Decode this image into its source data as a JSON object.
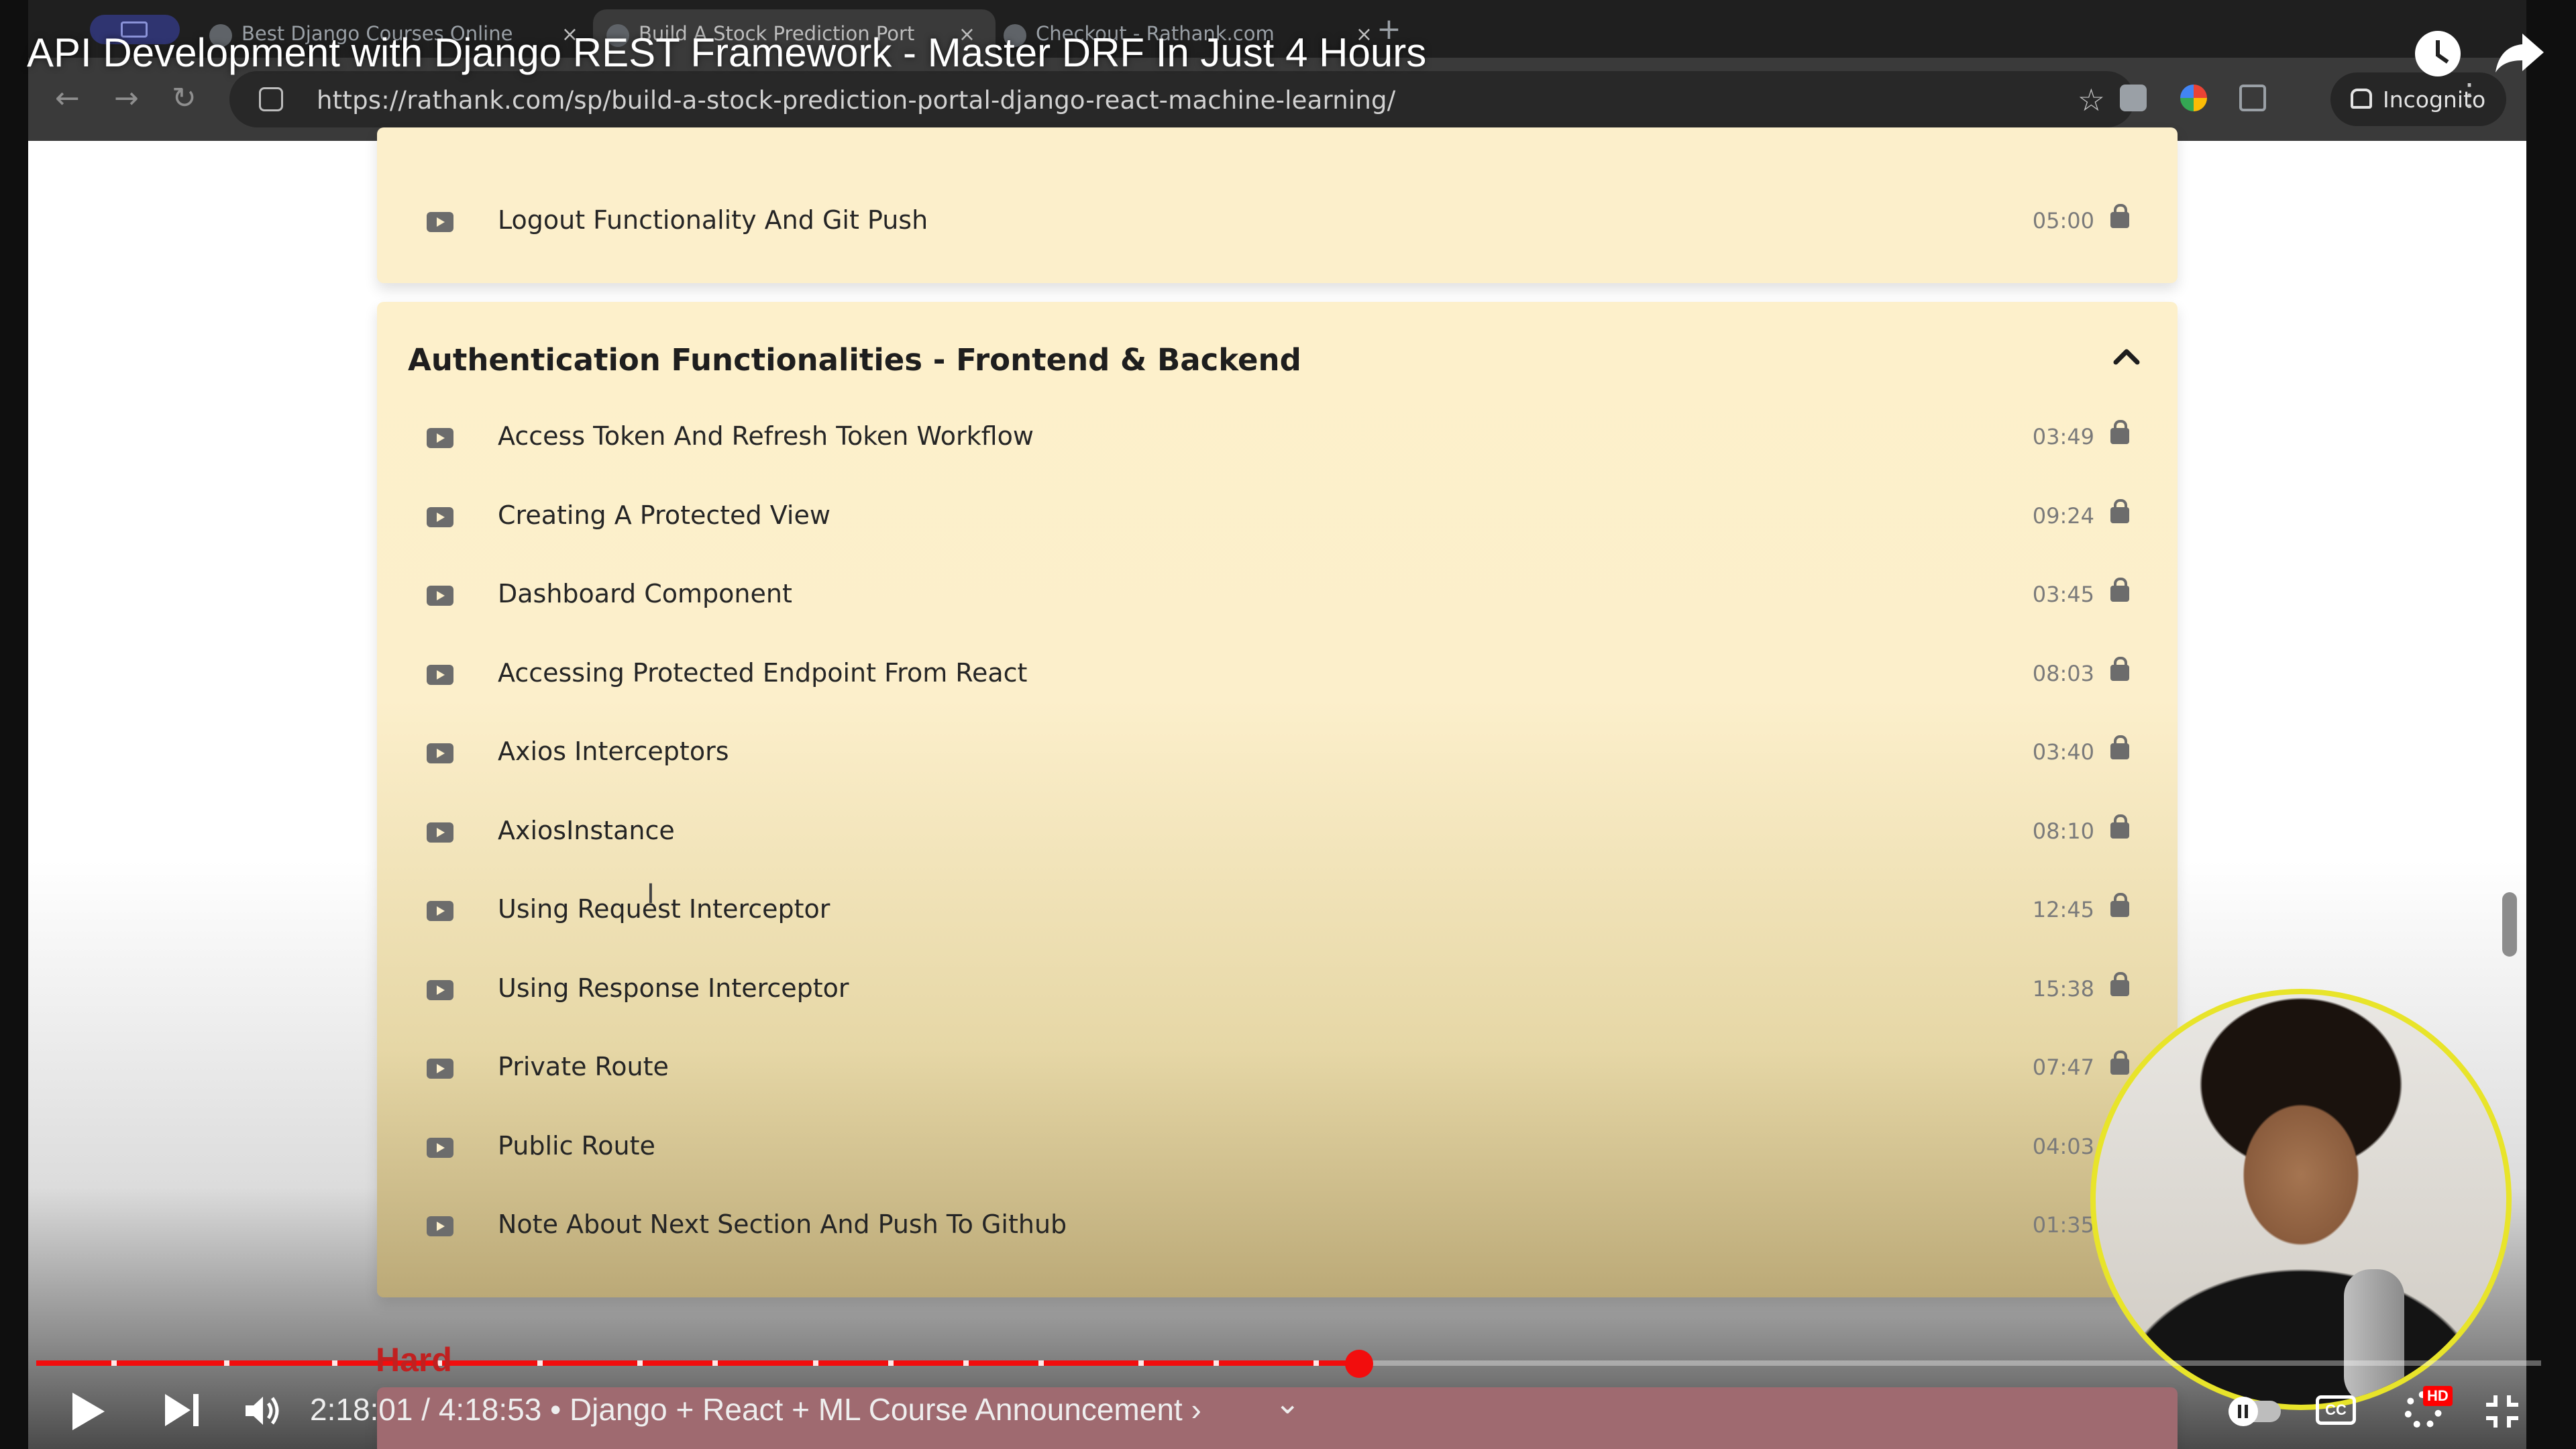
{
  "video": {
    "title": "API Development with Django REST Framework - Master DRF In Just 4 Hours",
    "time_text": "2:18:01 / 4:18:53 • Django + React + ML Course Announcement ›",
    "chapter_marker": "Hard",
    "progress_fraction": 0.528,
    "segment_markers": [
      0.03,
      0.075,
      0.118,
      0.16,
      0.2,
      0.24,
      0.27,
      0.31,
      0.34,
      0.37,
      0.4,
      0.44,
      0.47,
      0.51
    ],
    "controls": {
      "play": "play-icon",
      "next": "next-icon",
      "volume": "volume-icon",
      "chapters_chevron": "⌄",
      "autoplay": "autoplay-toggle-icon",
      "captions": "CC",
      "settings": "gear-icon",
      "quality_badge": "HD",
      "fullscreen": "exit-fullscreen-icon"
    },
    "top_right_icons": [
      "watch-later-icon",
      "share-icon"
    ]
  },
  "browser": {
    "tabs": [
      {
        "label": "Best Django Courses Online",
        "close": "×",
        "active": false
      },
      {
        "label": "Build A Stock Prediction Port",
        "close": "×",
        "active": true
      },
      {
        "label": "Checkout - Rathank.com",
        "close": "×",
        "active": false
      }
    ],
    "new_tab": "+",
    "nav": {
      "back": "←",
      "forward": "→",
      "reload": "↻"
    },
    "url": "https://rathank.com/sp/build-a-stock-prediction-portal-django-react-machine-learning/",
    "star": "☆",
    "incognito_label": "Incognito",
    "menu": "⋮"
  },
  "course": {
    "previous_section_lesson": {
      "title": "Logout Functionality And Git Push",
      "duration": "05:00"
    },
    "section": {
      "title": "Authentication Functionalities - Frontend & Backend",
      "lessons": [
        {
          "title": "Access Token And Refresh Token Workflow",
          "duration": "03:49"
        },
        {
          "title": "Creating A Protected View",
          "duration": "09:24"
        },
        {
          "title": "Dashboard Component",
          "duration": "03:45"
        },
        {
          "title": "Accessing Protected Endpoint From React",
          "duration": "08:03"
        },
        {
          "title": "Axios Interceptors",
          "duration": "03:40"
        },
        {
          "title": "AxiosInstance",
          "duration": "08:10"
        },
        {
          "title": "Using Request Interceptor",
          "duration": "12:45"
        },
        {
          "title": "Using Response Interceptor",
          "duration": "15:38"
        },
        {
          "title": "Private Route",
          "duration": "07:47"
        },
        {
          "title": "Public Route",
          "duration": "04:03"
        },
        {
          "title": "Note About Next Section And Push To Github",
          "duration": "01:35"
        }
      ]
    }
  },
  "colors": {
    "card": "#fcefcb",
    "progress": "#f20d0d",
    "avatar_ring": "#e8e42a"
  }
}
